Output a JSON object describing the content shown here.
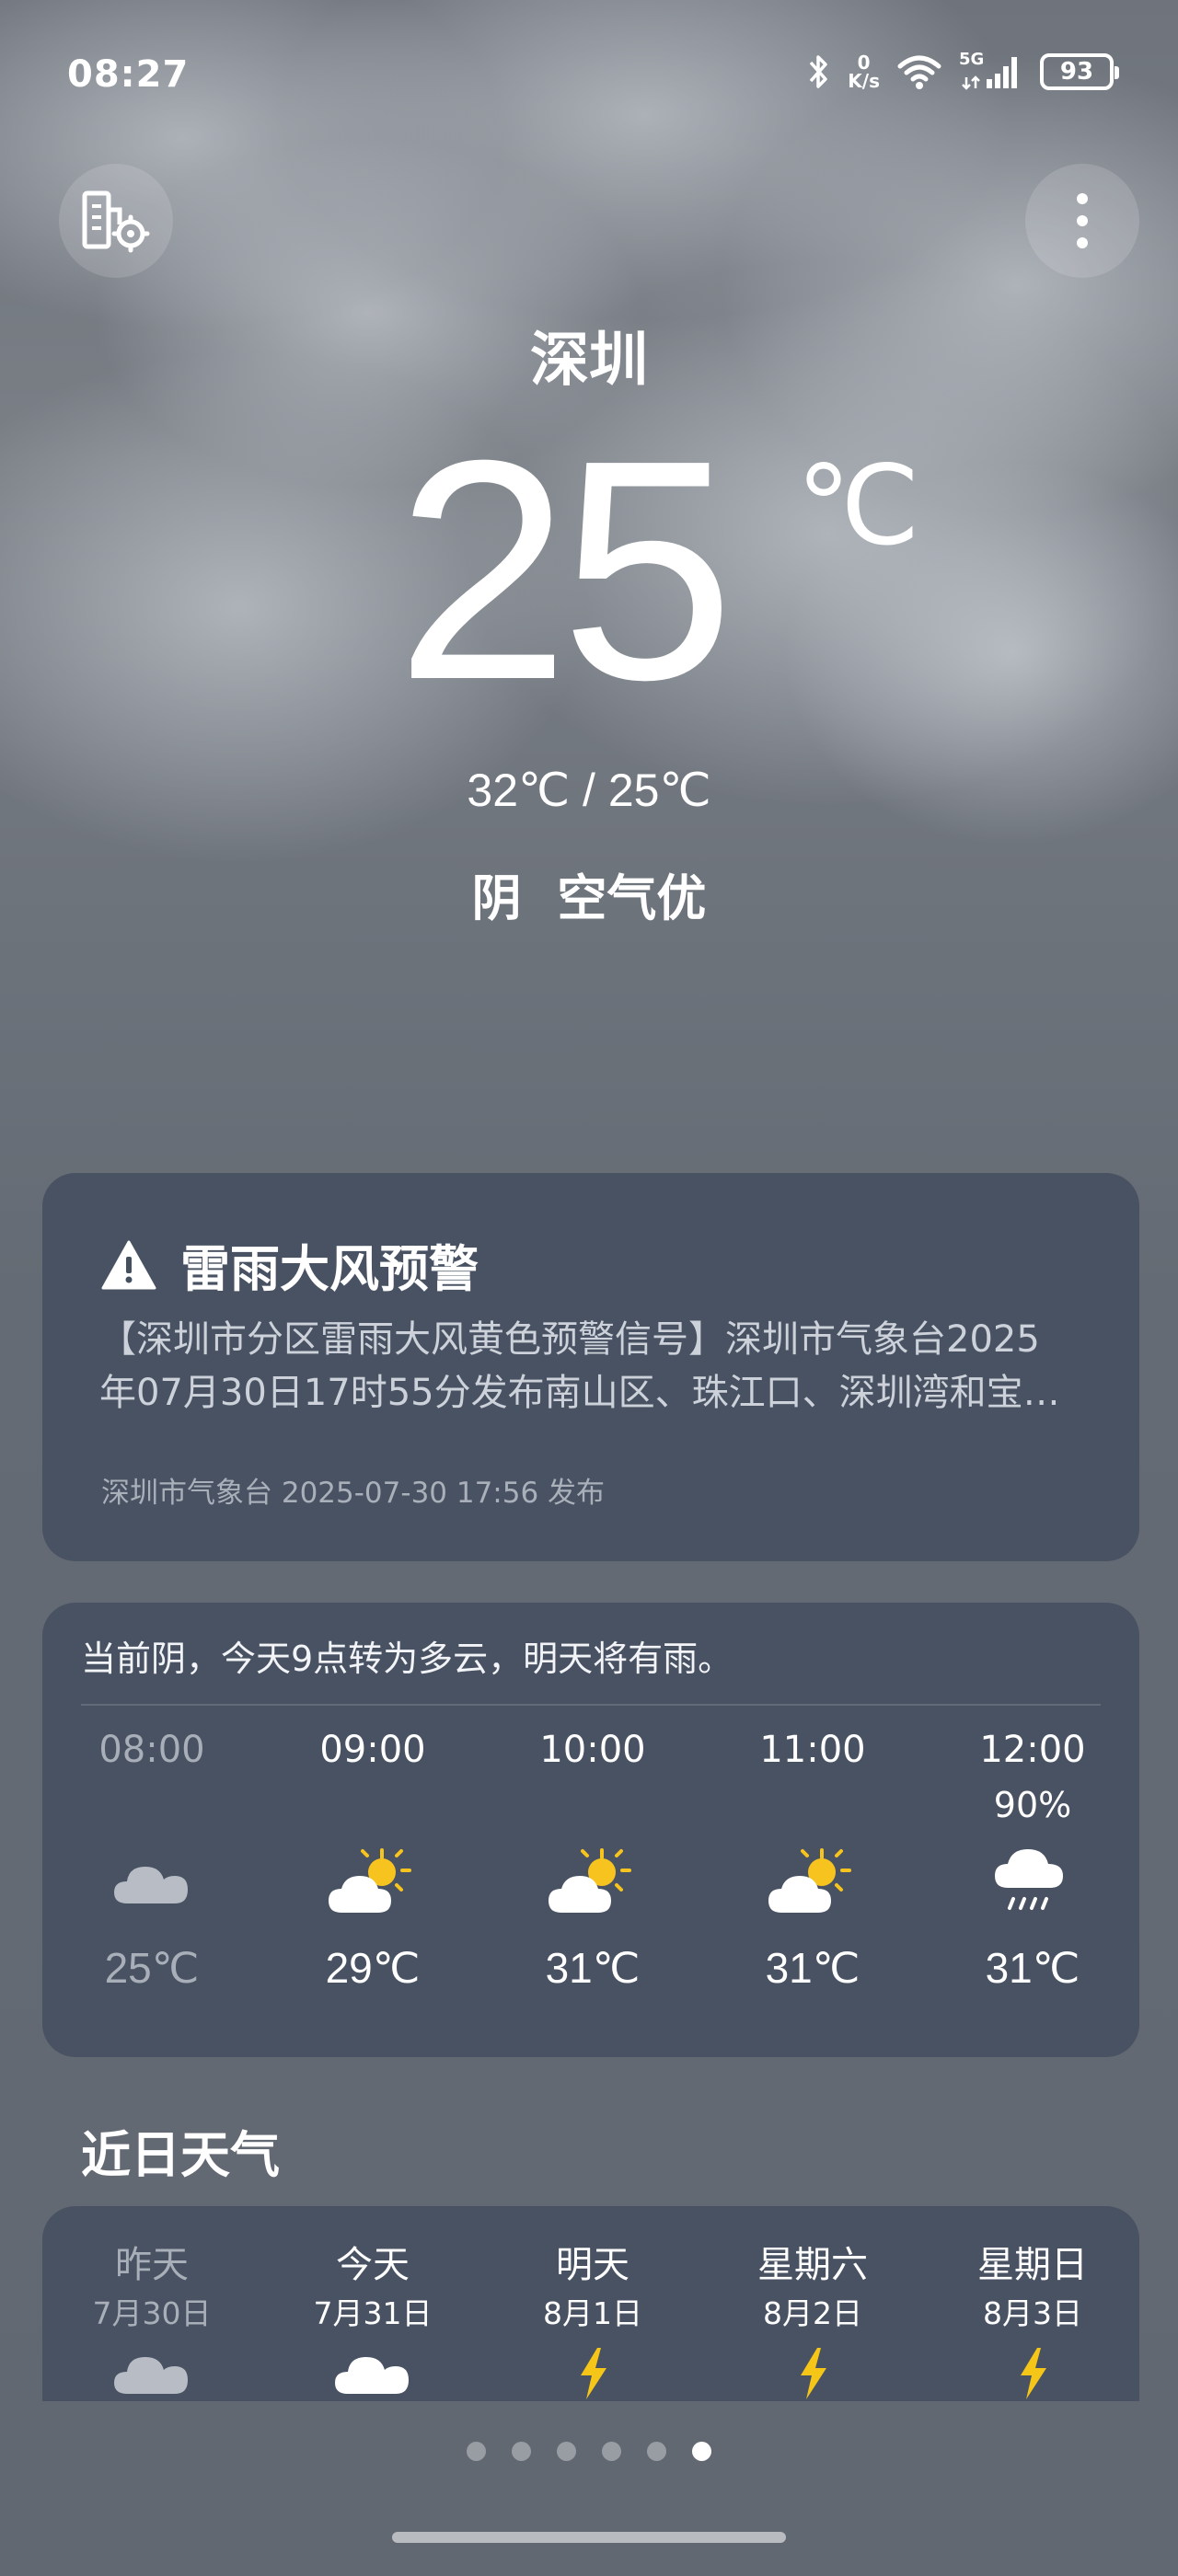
{
  "status_bar": {
    "time": "08:27",
    "net_speed_value": "0",
    "net_speed_unit": "K/s",
    "network": "5G",
    "battery": "93"
  },
  "header": {
    "city": "深圳",
    "temperature": "25",
    "temperature_unit": "℃",
    "range": "32℃ / 25℃",
    "condition": "阴 空气优"
  },
  "alert": {
    "title": "雷雨大风预警",
    "body_line1": "【深圳市分区雷雨大风黄色预警信号】深圳市气象台2025",
    "body_line2": "年07月30日17时55分发布南山区、珠江口、深圳湾和宝…",
    "footer": "深圳市气象台 2025-07-30 17:56 发布"
  },
  "hourly": {
    "summary": "当前阴，今天9点转为多云，明天将有雨。",
    "items": [
      {
        "time": "08:00",
        "prob": "",
        "icon": "cloudy-icon",
        "temp": "25℃"
      },
      {
        "time": "09:00",
        "prob": "",
        "icon": "partly-cloudy-icon",
        "temp": "29℃"
      },
      {
        "time": "10:00",
        "prob": "",
        "icon": "partly-cloudy-icon",
        "temp": "31℃"
      },
      {
        "time": "11:00",
        "prob": "",
        "icon": "partly-cloudy-icon",
        "temp": "31℃"
      },
      {
        "time": "12:00",
        "prob": "90%",
        "icon": "rain-icon",
        "temp": "31℃"
      }
    ]
  },
  "daily": {
    "title": "近日天气",
    "items": [
      {
        "name": "昨天",
        "date": "7月30日",
        "icon": "cloudy-icon"
      },
      {
        "name": "今天",
        "date": "7月31日",
        "icon": "partly-cloudy-icon"
      },
      {
        "name": "明天",
        "date": "8月1日",
        "icon": "thunder-icon"
      },
      {
        "name": "星期六",
        "date": "8月2日",
        "icon": "thunder-icon"
      },
      {
        "name": "星期日",
        "date": "8月3日",
        "icon": "thunder-icon"
      }
    ]
  },
  "pager": {
    "count": 6,
    "active_index": 5
  },
  "colors": {
    "sun": "#f7c31f",
    "bolt": "#f5c518",
    "card": "#444f60"
  }
}
